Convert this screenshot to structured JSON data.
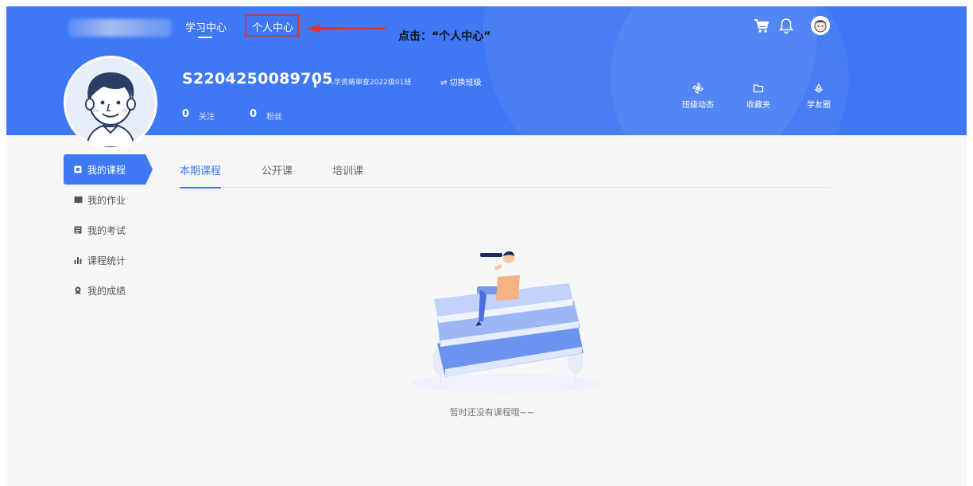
{
  "nav": {
    "study_center": "学习中心",
    "personal_center": "个人中心"
  },
  "annotation": "点击：“个人中心”",
  "icons": {
    "cart": "shopping-cart-icon",
    "bell": "bell-icon",
    "avatar": "user-avatar"
  },
  "profile": {
    "username": "S2204250089705",
    "class_name": "入学资格审查2022级01班",
    "switch_label": "⇌ 切换班级",
    "follow_count": "0",
    "follow_label": "关注",
    "fans_count": "0",
    "fans_label": "粉丝"
  },
  "quick_links": [
    {
      "label": "班级动态",
      "icon": "pinwheel-icon"
    },
    {
      "label": "收藏夹",
      "icon": "folder-icon"
    },
    {
      "label": "学友圈",
      "icon": "recycle-icon"
    }
  ],
  "sidebar": {
    "items": [
      {
        "label": "我的课程",
        "icon": "course-icon",
        "active": true
      },
      {
        "label": "我的作业",
        "icon": "book-icon",
        "active": false
      },
      {
        "label": "我的考试",
        "icon": "exam-icon",
        "active": false
      },
      {
        "label": "课程统计",
        "icon": "bar-chart-icon",
        "active": false
      },
      {
        "label": "我的成绩",
        "icon": "award-icon",
        "active": false
      }
    ]
  },
  "tabs": [
    {
      "label": "本期课程",
      "active": true
    },
    {
      "label": "公开课",
      "active": false
    },
    {
      "label": "培训课",
      "active": false
    }
  ],
  "empty_state": {
    "message": "暂时还没有课程哦~~"
  },
  "colors": {
    "brand": "#3f78f4",
    "highlight_box": "#e4322b"
  }
}
